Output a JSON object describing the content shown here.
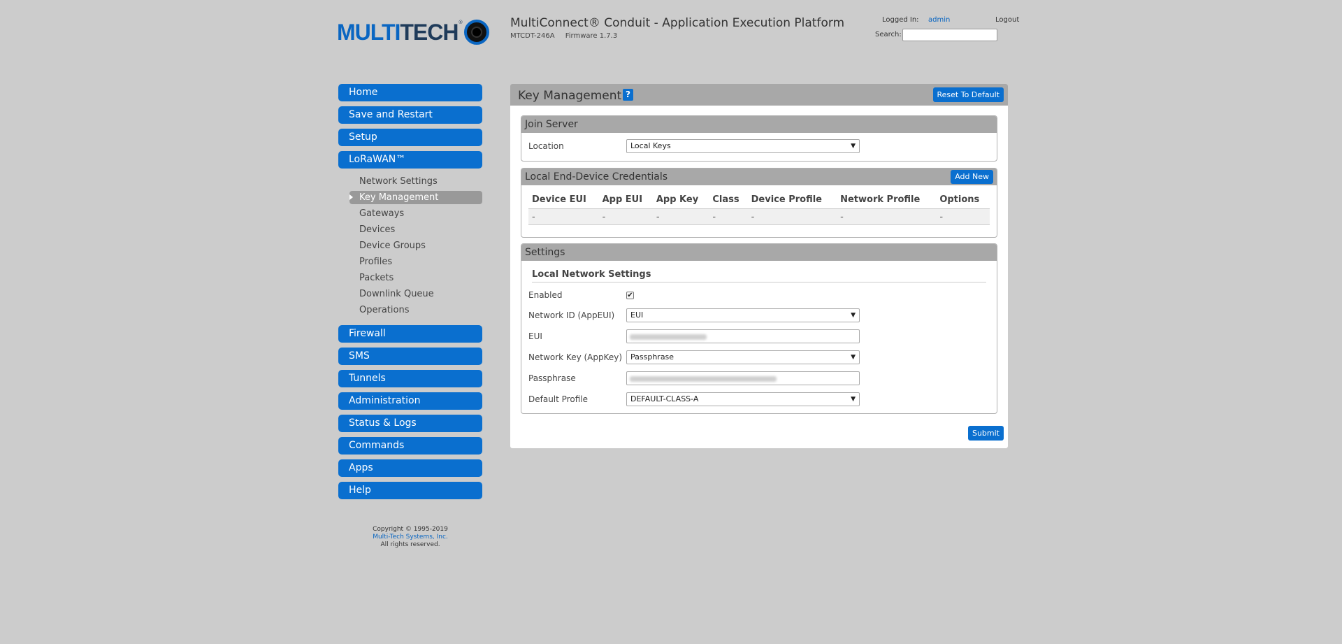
{
  "brand": {
    "logo_multi": "MULTI",
    "logo_tech": "TECH",
    "logo_mark": "®"
  },
  "header": {
    "title": "MultiConnect® Conduit - Application Execution Platform",
    "model": "MTCDT-246A",
    "firmware": "Firmware 1.7.3",
    "logged_in_label": "Logged In:",
    "user": "admin",
    "logout": "Logout",
    "search_label": "Search:",
    "search_value": ""
  },
  "sidebar": {
    "top_items": [
      "Home",
      "Save and Restart",
      "Setup",
      "LoRaWAN™"
    ],
    "lorawan_sub": [
      "Network Settings",
      "Key Management",
      "Gateways",
      "Devices",
      "Device Groups",
      "Profiles",
      "Packets",
      "Downlink Queue",
      "Operations"
    ],
    "active_sub": "Key Management",
    "bottom_items": [
      "Firewall",
      "SMS",
      "Tunnels",
      "Administration",
      "Status & Logs",
      "Commands",
      "Apps",
      "Help"
    ],
    "copyright_line1": "Copyright © 1995-2019",
    "copyright_link": "Multi-Tech Systems, Inc.",
    "copyright_line3": "All rights reserved."
  },
  "main": {
    "title": "Key Management",
    "help_icon": "?",
    "reset_button": "Reset To Default",
    "join_server": {
      "title": "Join Server",
      "location_label": "Location",
      "location_value": "Local Keys"
    },
    "credentials": {
      "title": "Local End-Device Credentials",
      "add_button": "Add New",
      "columns": [
        "Device EUI",
        "App EUI",
        "App Key",
        "Class",
        "Device Profile",
        "Network Profile",
        "Options"
      ],
      "rows": [
        [
          "-",
          "-",
          "-",
          "-",
          "-",
          "-",
          "-"
        ]
      ]
    },
    "settings": {
      "title": "Settings",
      "subsection": "Local Network Settings",
      "enabled_label": "Enabled",
      "enabled": true,
      "network_id_label": "Network ID (AppEUI)",
      "network_id_value": "EUI",
      "eui_label": "EUI",
      "network_key_label": "Network Key (AppKey)",
      "network_key_value": "Passphrase",
      "passphrase_label": "Passphrase",
      "default_profile_label": "Default Profile",
      "default_profile_value": "DEFAULT-CLASS-A"
    },
    "submit_button": "Submit"
  },
  "colors": {
    "accent": "#0a6fcf",
    "background": "#cccccc",
    "section_header": "#a8a8a8"
  }
}
